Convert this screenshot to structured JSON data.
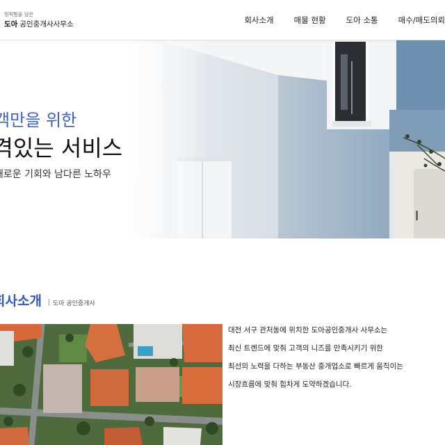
{
  "header": {
    "logo_tagline": "정직함을 담은",
    "logo_name_strong": "도아",
    "logo_name_rest": "공인중개사사무소",
    "nav": [
      "회사소개",
      "매물 현황",
      "도아 소통",
      "매수/매도의뢰"
    ]
  },
  "hero": {
    "subtitle": "고객만을 위한",
    "title": "품격있는 서비스",
    "description": "새로운 기회와 남다른 노하우"
  },
  "section": {
    "title": "회사소개",
    "subtitle": "도아 공인중개사",
    "intro_lines": [
      "대전 서구 관저동에 위치한 도아공인중개사 사무소는",
      "최신 트렌드에 맞춰 고객의 니즈를 만족시키기 위한",
      "최선의 노력을 다하는 부동산 중개업소로 빠르게 움직이는",
      "시장흐름에 맞춰 힘차게 도약하겠습니다."
    ]
  },
  "colors": {
    "accent_blue": "#3d63c8",
    "wall_blue": "#9db3c8",
    "roof_orange": "#d8683a"
  }
}
